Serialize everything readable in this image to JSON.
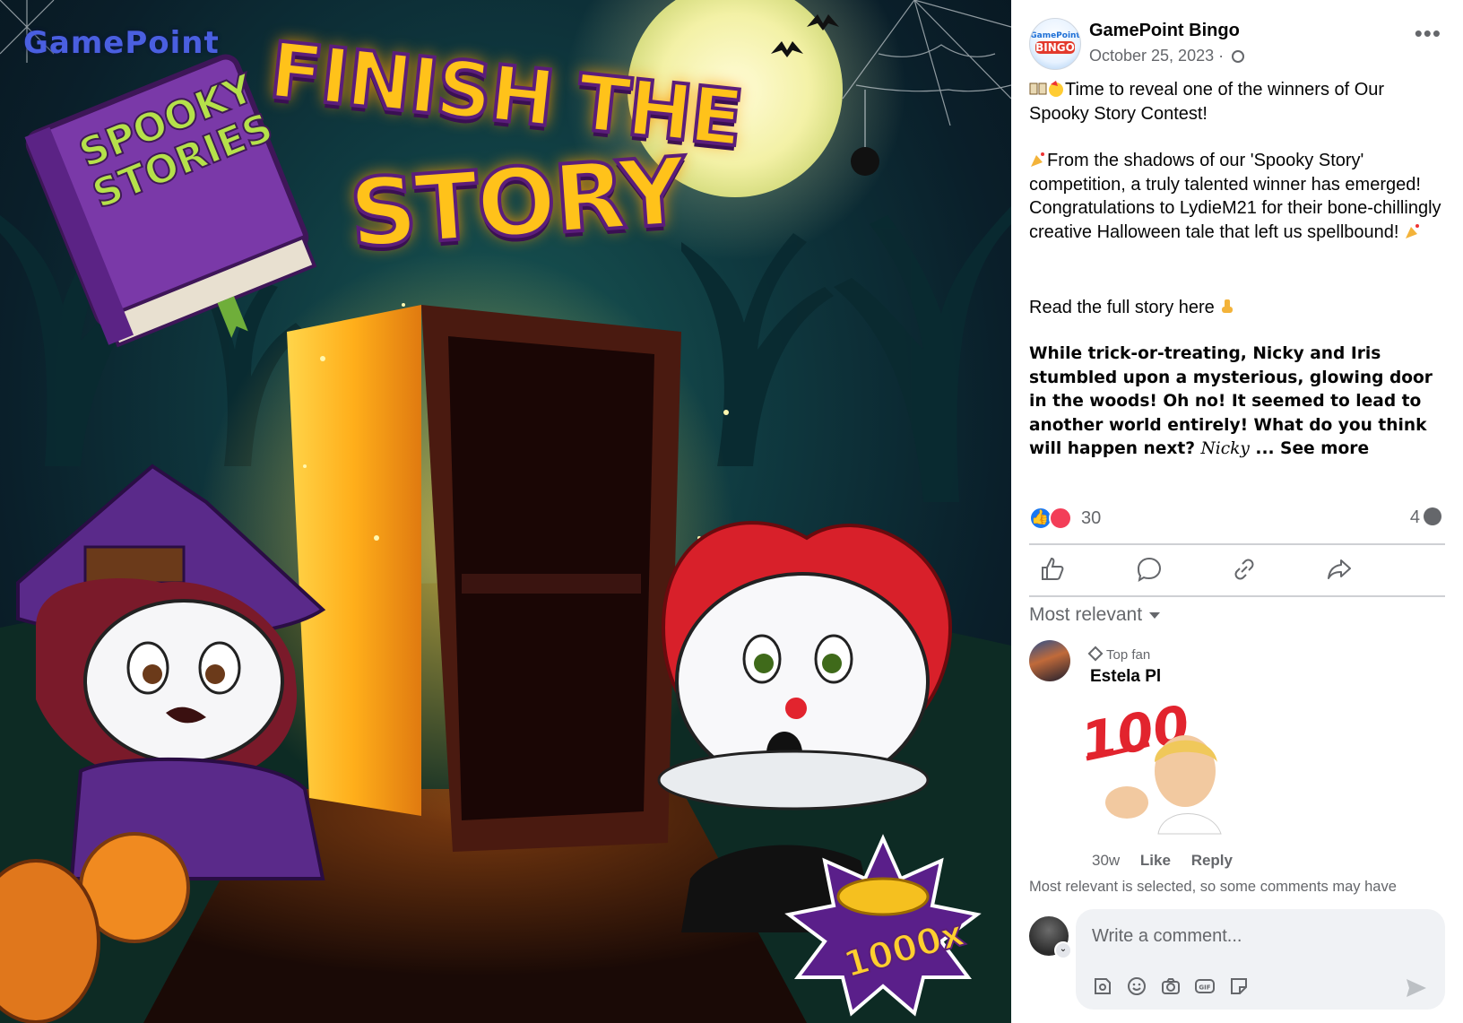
{
  "image": {
    "brand": "GamePoint",
    "title_line1": "FINISH THE",
    "title_line2": "STORY",
    "book_title": "SPOOKY STORIES",
    "coin_badge": "1000x"
  },
  "post": {
    "page_name": "GamePoint Bingo",
    "avatar_text_top": "GamePoint",
    "avatar_text_bottom": "BINGO",
    "date": "October 25, 2023 ·",
    "more": "•••",
    "text1": "Time to reveal one of the winners of Our Spooky Story Contest!",
    "text2": "From the shadows of our 'Spooky Story' competition, a truly talented winner has emerged! Congratulations to LydieM21 for their bone-chillingly creative Halloween tale that left us spellbound!",
    "text3": "Read the full story here",
    "story_bold": "While trick-or-treating, Nicky and Iris stumbled upon a mysterious, glowing door in the woods! Oh no! It seemed to lead to another world entirely! What do you think will happen next?",
    "story_italic": "Nicky",
    "see_more": "... See more"
  },
  "reactions": {
    "count": "30",
    "comments": "4"
  },
  "actions": [
    "like-icon",
    "comment-icon",
    "share-link-icon",
    "share-icon"
  ],
  "comments": {
    "sort_label": "Most relevant",
    "items": [
      {
        "badge": "Top fan",
        "name": "Estela Pl",
        "sticker_text": "100",
        "time": "30w",
        "like": "Like",
        "reply": "Reply"
      }
    ],
    "notice": "Most relevant is selected, so some comments may have"
  },
  "composer": {
    "placeholder": "Write a comment...",
    "tools": [
      "avatar-sticker-icon",
      "emoji-icon",
      "camera-icon",
      "gif-icon",
      "sticker-icon"
    ]
  },
  "colors": {
    "accent": "#1877f2",
    "love": "#f33e58",
    "muted": "#65676b",
    "composer_bg": "#f0f2f5"
  }
}
